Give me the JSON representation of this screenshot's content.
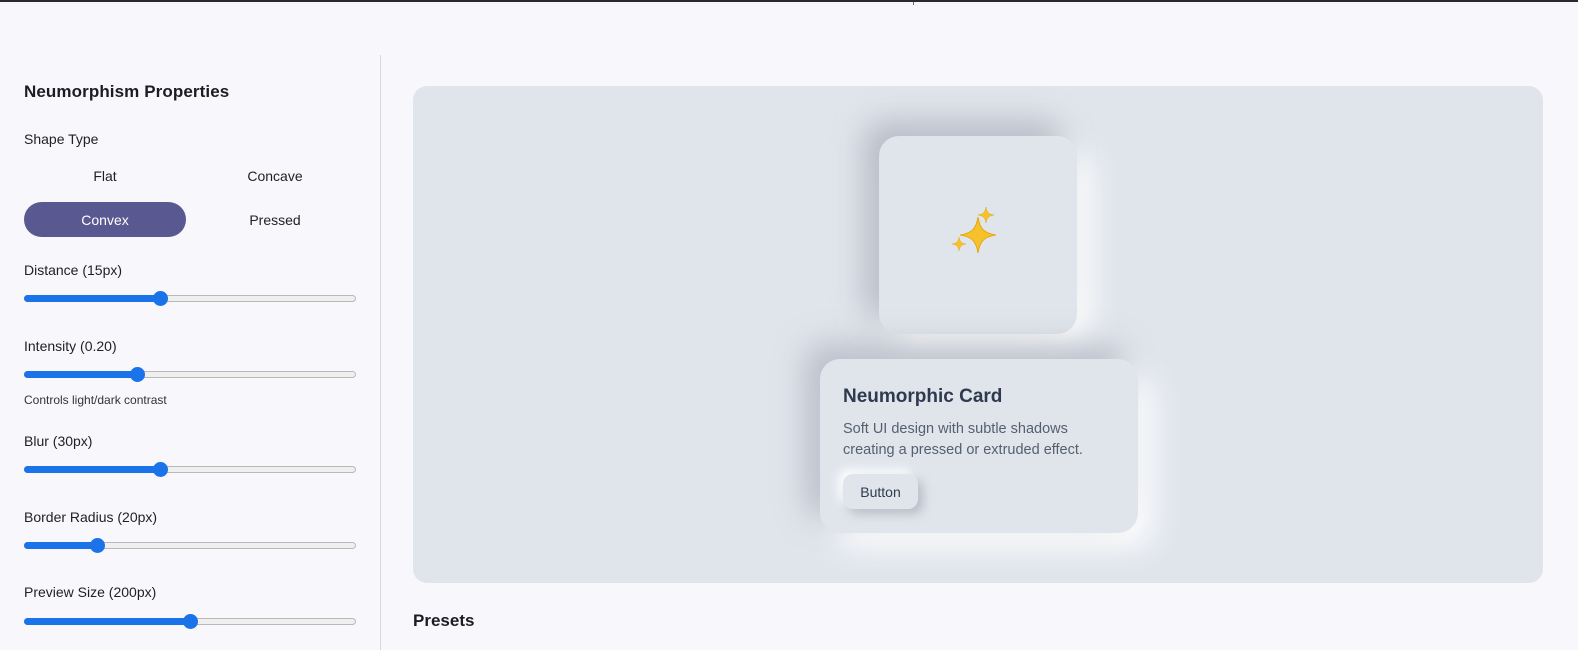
{
  "panel": {
    "title": "Neumorphism Properties",
    "shape_type_label": "Shape Type",
    "shapes": [
      {
        "label": "Flat",
        "active": false
      },
      {
        "label": "Concave",
        "active": false
      },
      {
        "label": "Convex",
        "active": true
      },
      {
        "label": "Pressed",
        "active": false
      }
    ],
    "sliders": [
      {
        "label": "Distance (15px)",
        "value": 0.41
      },
      {
        "label": "Intensity (0.20)",
        "value": 0.34,
        "hint": "Controls light/dark contrast"
      },
      {
        "label": "Blur (30px)",
        "value": 0.41
      },
      {
        "label": "Border Radius (20px)",
        "value": 0.22
      },
      {
        "label": "Preview Size (200px)",
        "value": 0.5
      }
    ]
  },
  "preview": {
    "icon": "sparkles-icon",
    "card": {
      "title": "Neumorphic Card",
      "text": "Soft UI design with subtle shadows creating a pressed or extruded effect.",
      "button_label": "Button"
    }
  },
  "presets": {
    "title": "Presets"
  },
  "colors": {
    "accent": "#5a5890",
    "slider": "#1a73e8",
    "surface": "#e0e5ec",
    "background": "#f8f7fc"
  }
}
